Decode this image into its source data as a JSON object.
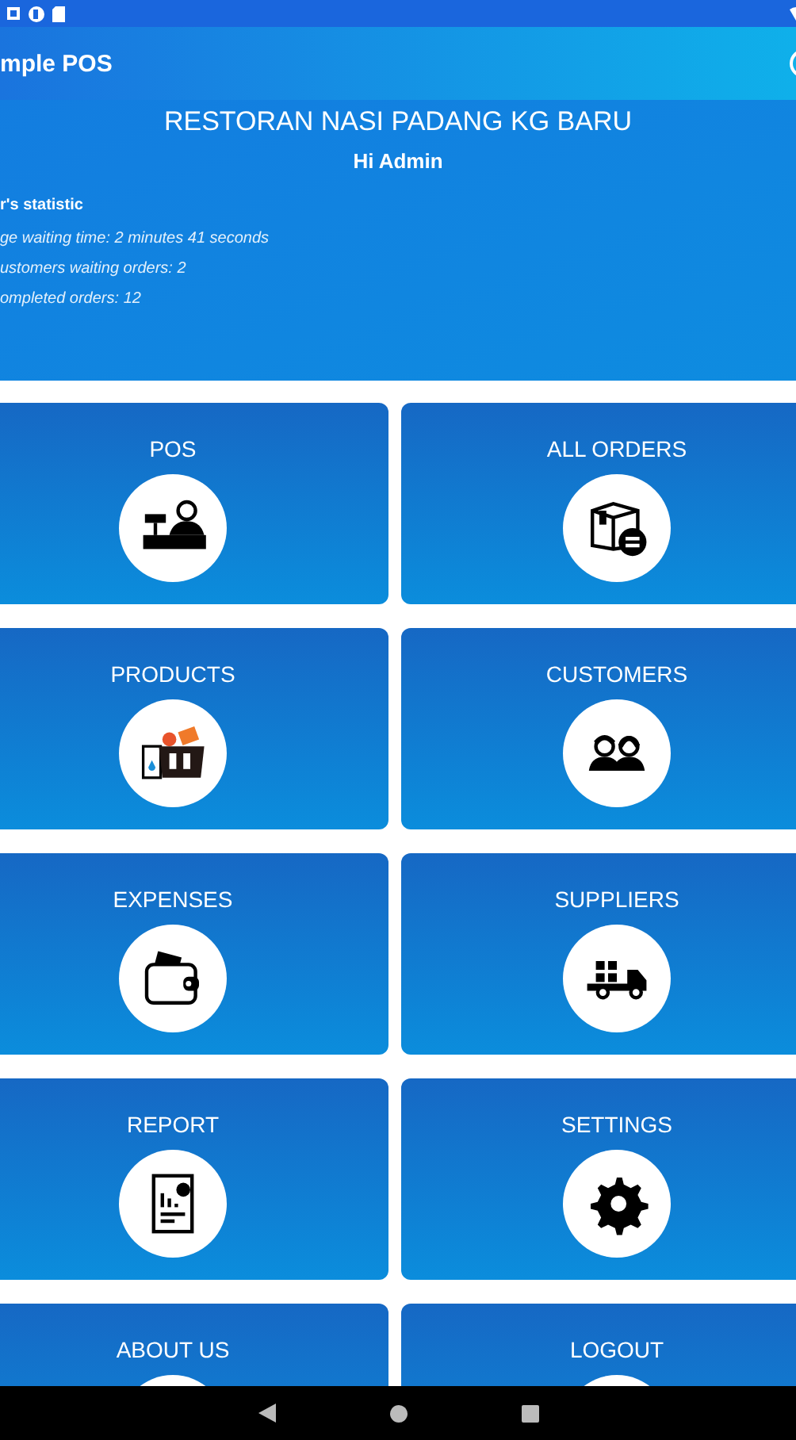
{
  "app_bar": {
    "title": "mple POS"
  },
  "header": {
    "title": "RESTORAN NASI PADANG KG BARU",
    "greeting": "Hi Admin",
    "statistic_heading": "r's statistic",
    "statistics": [
      "ge waiting time: 2 minutes 41 seconds",
      "ustomers waiting orders: 2",
      "ompleted orders: 12"
    ]
  },
  "menu": [
    {
      "label": "POS",
      "kind": "pos"
    },
    {
      "label": "ALL ORDERS",
      "kind": "orders"
    },
    {
      "label": "PRODUCTS",
      "kind": "products"
    },
    {
      "label": "CUSTOMERS",
      "kind": "customers"
    },
    {
      "label": "EXPENSES",
      "kind": "expenses"
    },
    {
      "label": "SUPPLIERS",
      "kind": "suppliers"
    },
    {
      "label": "REPORT",
      "kind": "report"
    },
    {
      "label": "SETTINGS",
      "kind": "settings"
    },
    {
      "label": "ABOUT US"
    },
    {
      "label": "LOGOUT"
    }
  ]
}
